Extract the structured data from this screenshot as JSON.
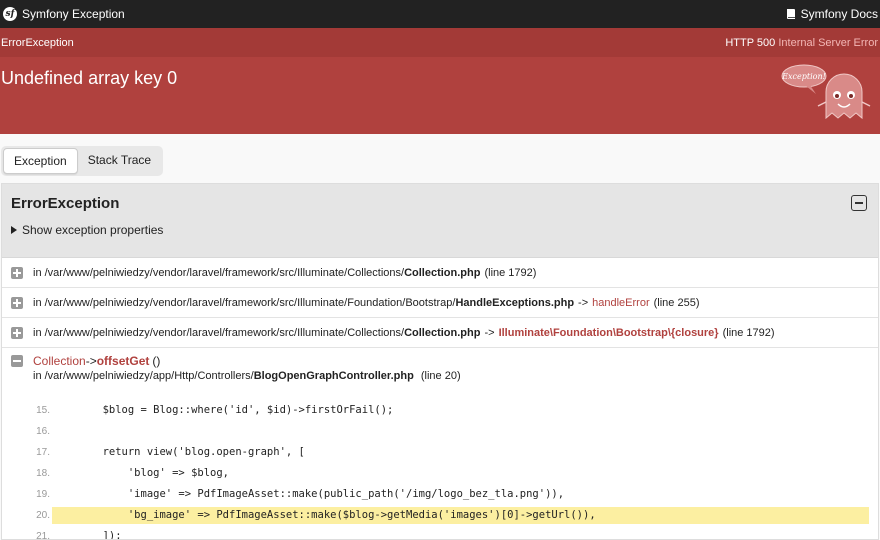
{
  "topbar": {
    "logo_glyph": "sf",
    "title": "Symfony Exception",
    "docs_label": "Symfony Docs"
  },
  "header": {
    "exception_class": "ErrorException",
    "status_code": "HTTP 500",
    "status_text": "Internal Server Error",
    "message": "Undefined array key 0",
    "ghost_label": "Exception!"
  },
  "tabs": [
    {
      "label": "Exception",
      "active": true
    },
    {
      "label": "Stack Trace",
      "active": false
    }
  ],
  "panel": {
    "class_name": "ErrorException",
    "show_props_label": "Show exception properties"
  },
  "trace": [
    {
      "prefix": "in /var/www/pelniwiedzy/vendor/laravel/framework/src/Illuminate/Collections/",
      "file": "Collection.php",
      "arrow": "",
      "func": "",
      "line": "(line 1792)"
    },
    {
      "prefix": "in /var/www/pelniwiedzy/vendor/laravel/framework/src/Illuminate/Foundation/Bootstrap/",
      "file": "HandleExceptions.php",
      "arrow": "->",
      "func": "handleError",
      "line": "(line 255)"
    },
    {
      "prefix": "in /var/www/pelniwiedzy/vendor/laravel/framework/src/Illuminate/Collections/",
      "file": "Collection.php",
      "arrow": "->",
      "func": "Illuminate\\Foundation\\Bootstrap\\{closure}",
      "line": "(line 1792)"
    }
  ],
  "expanded": {
    "cls": "Collection",
    "arrow": "->",
    "method": "offsetGet",
    "parens": "()",
    "prefix": "in /var/www/pelniwiedzy/app/Http/Controllers/",
    "file": "BlogOpenGraphController.php",
    "line": "(line 20)"
  },
  "code": [
    {
      "no": "15.",
      "text": "        $blog = Blog::where('id', $id)->firstOrFail();",
      "highlight": false
    },
    {
      "no": "16.",
      "text": "",
      "highlight": false
    },
    {
      "no": "17.",
      "text": "        return view('blog.open-graph', [",
      "highlight": false
    },
    {
      "no": "18.",
      "text": "            'blog' => $blog,",
      "highlight": false
    },
    {
      "no": "19.",
      "text": "            'image' => PdfImageAsset::make(public_path('/img/logo_bez_tla.png')),",
      "highlight": false
    },
    {
      "no": "20.",
      "text": "            'bg_image' => PdfImageAsset::make($blog->getMedia('images')[0]->getUrl()),",
      "highlight": true
    },
    {
      "no": "21.",
      "text": "        ]);",
      "highlight": false
    }
  ],
  "colors": {
    "header": "#b0413e",
    "highlight": "#fcefa1",
    "function": "#b0413e"
  }
}
